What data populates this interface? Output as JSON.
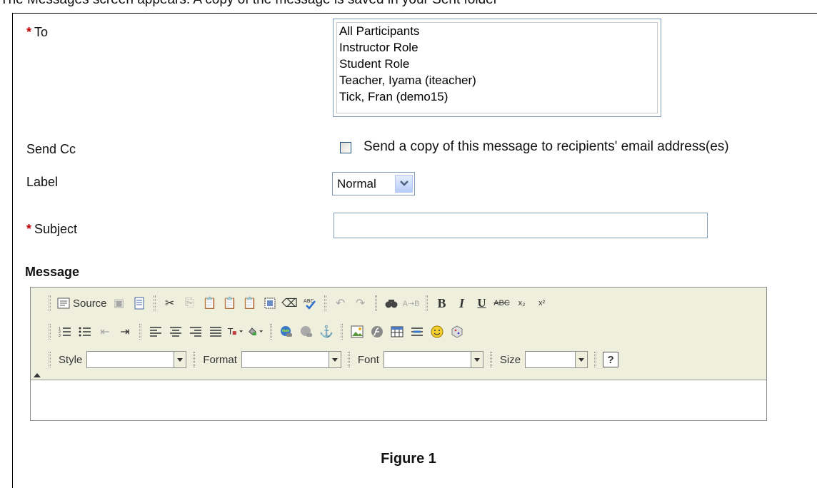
{
  "doc_top_line": "The Messages screen appears. A copy of the message is saved in your Sent folder",
  "form": {
    "to_label": "To",
    "required_marker": "*",
    "recipients": [
      "All Participants",
      "Instructor Role",
      "Student Role",
      "Teacher, Iyama (iteacher)",
      "Tick, Fran (demo15)"
    ],
    "send_cc_label": "Send Cc",
    "send_cc_checkbox_text": "Send a copy of this message to recipients' email address(es)",
    "label_label": "Label",
    "label_selected": "Normal",
    "subject_label": "Subject",
    "subject_value": "",
    "message_label": "Message"
  },
  "editor": {
    "source_label": "Source",
    "style_label": "Style",
    "format_label": "Format",
    "font_label": "Font",
    "size_label": "Size",
    "help_glyph": "?"
  },
  "caption": "Figure 1"
}
